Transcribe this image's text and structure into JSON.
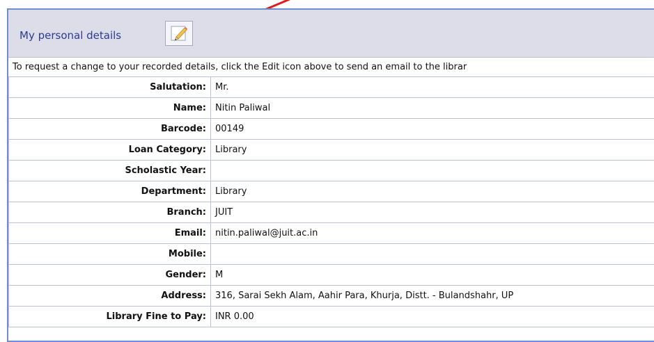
{
  "header": {
    "title": "My personal details",
    "edit_icon": "pencil-edit-icon"
  },
  "notice": "To request a change to your recorded details, click the Edit icon above to send an email to the librar",
  "details": [
    {
      "label": "Salutation:",
      "value": "Mr."
    },
    {
      "label": "Name:",
      "value": "Nitin Paliwal"
    },
    {
      "label": "Barcode:",
      "value": "00149"
    },
    {
      "label": "Loan Category:",
      "value": "Library"
    },
    {
      "label": "Scholastic Year:",
      "value": ""
    },
    {
      "label": "Department:",
      "value": "Library"
    },
    {
      "label": "Branch:",
      "value": "JUIT"
    },
    {
      "label": "Email:",
      "value": "nitin.paliwal@juit.ac.in"
    },
    {
      "label": "Mobile:",
      "value": ""
    },
    {
      "label": "Gender:",
      "value": "M"
    },
    {
      "label": "Address:",
      "value": "316, Sarai Sekh Alam, Aahir Para, Khurja, Distt. - Bulandshahr, UP"
    },
    {
      "label": "Library Fine to Pay:",
      "value": "INR 0.00"
    }
  ],
  "colors": {
    "header_bg": "#dcdde9",
    "title_color": "#2c3b8c",
    "frame_border": "#6d8fd0",
    "arrow": "#e01b1b"
  }
}
